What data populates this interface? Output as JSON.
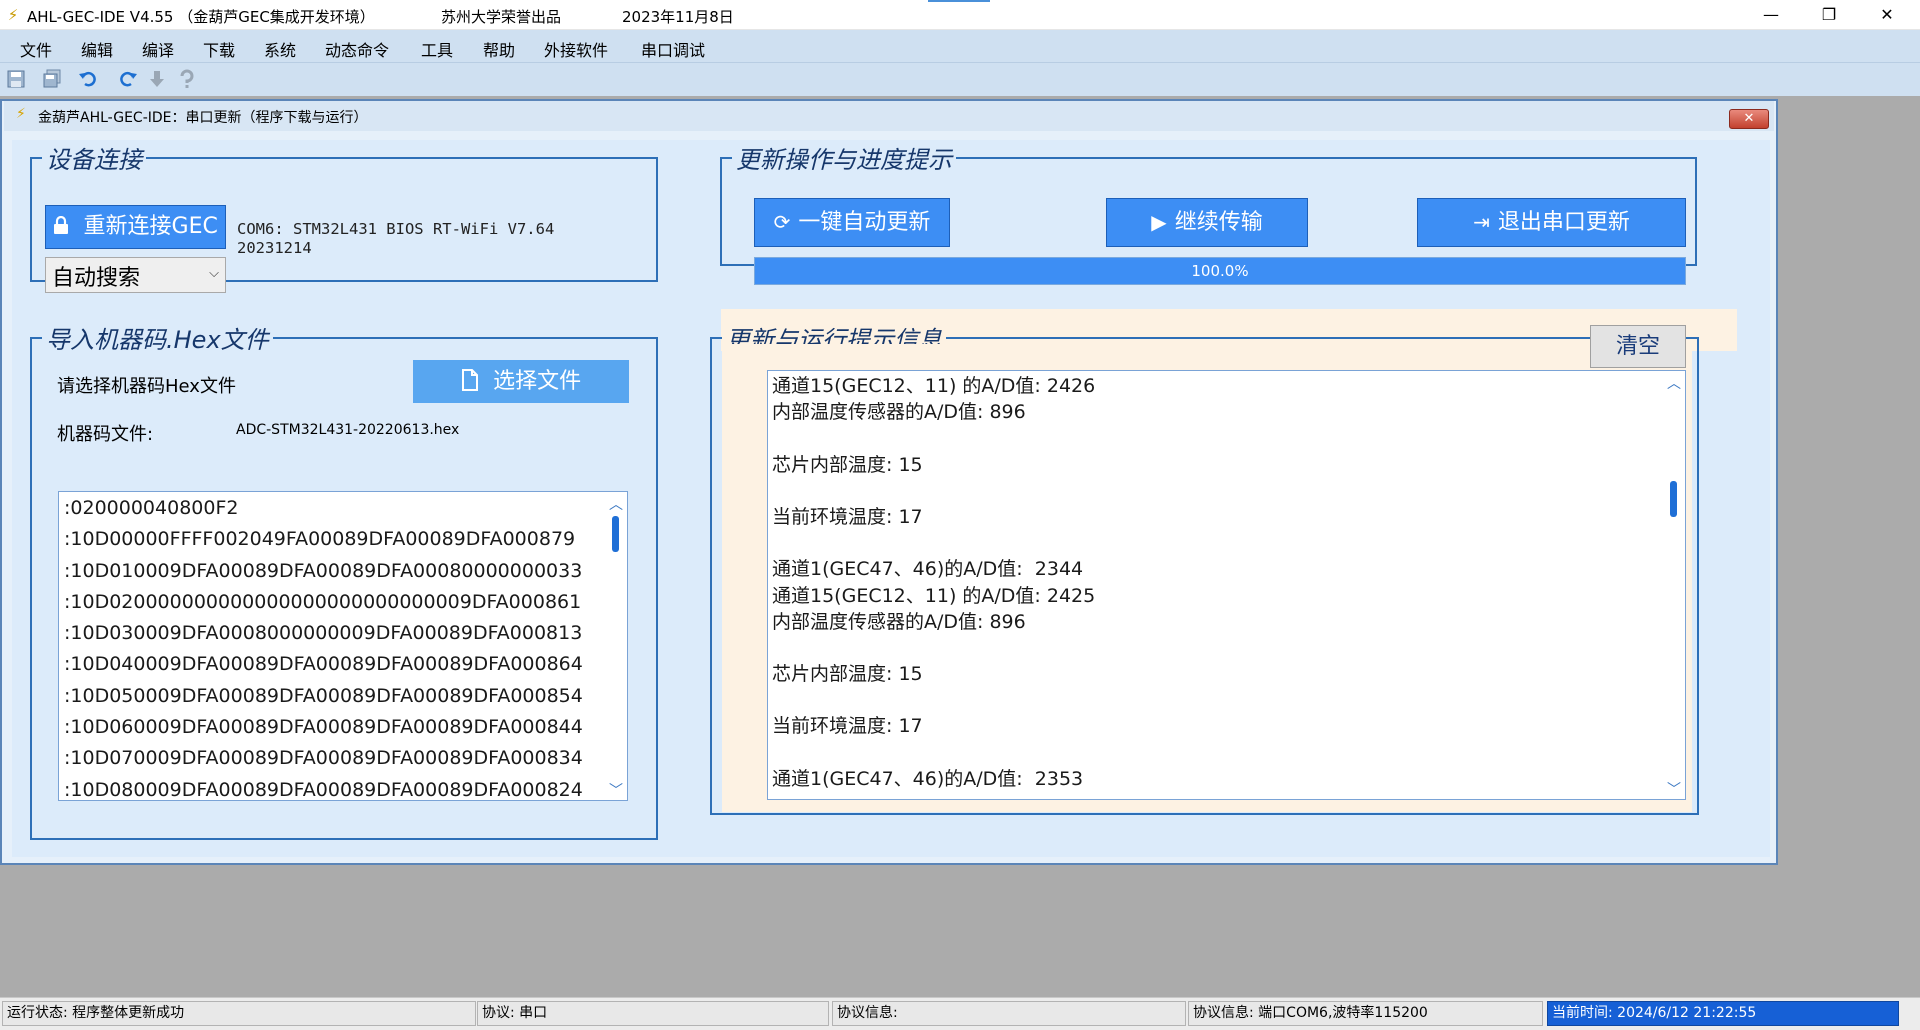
{
  "window": {
    "title": "AHL-GEC-IDE V4.55 （金葫芦GEC集成开发环境）",
    "org": "苏州大学荣誉出品",
    "date": "2023年11月8日",
    "minimize": "—",
    "restore": "❐",
    "close": "✕"
  },
  "menu": [
    "文件",
    "编辑",
    "编译",
    "下载",
    "系统",
    "动态命令",
    "工具",
    "帮助",
    "外接软件",
    "串口调试"
  ],
  "toolbar": [
    "save-icon",
    "save-all-icon",
    "undo-icon",
    "redo-icon",
    "download-icon",
    "help-icon"
  ],
  "dialog": {
    "title": "金葫芦AHL-GEC-IDE：串口更新（程序下载与运行）",
    "close": "✕",
    "device": {
      "legend": "设备连接",
      "reconnect_label": "重新连接GEC",
      "search_mode": "自动搜索",
      "device_info_line1": "COM6:  STM32L431 BIOS RT-WiFi V7.64",
      "device_info_line2": "20231214"
    },
    "import": {
      "legend": "导入机器码.Hex文件",
      "prompt": "请选择机器码Hex文件",
      "choose_label": "选择文件",
      "file_label": "机器码文件:",
      "file_name": "ADC-STM32L431-20220613.hex",
      "hex_lines": [
        ":020000040800F2",
        ":10D00000FFFF002049FA00089DFA00089DFA000879",
        ":10D010009DFA00089DFA00089DFA00080000000033",
        ":10D020000000000000000000000000009DFA000861",
        ":10D030009DFA0008000000009DFA00089DFA000813",
        ":10D040009DFA00089DFA00089DFA00089DFA000864",
        ":10D050009DFA00089DFA00089DFA00089DFA000854",
        ":10D060009DFA00089DFA00089DFA00089DFA000844",
        ":10D070009DFA00089DFA00089DFA00089DFA000834",
        ":10D080009DFA00089DFA00089DFA00089DFA000824"
      ]
    },
    "update": {
      "legend": "更新操作与进度提示",
      "auto_update_label": "一键自动更新",
      "continue_label": "继续传输",
      "exit_label": "退出串口更新",
      "progress_text": "100.0%",
      "progress_value": 1.0
    },
    "log": {
      "legend": "更新与运行提示信息",
      "clear_label": "清空",
      "lines": [
        "通道15(GEC12、11) 的A/D值: 2426",
        "内部温度传感器的A/D值: 896",
        "",
        "芯片内部温度: 15",
        "",
        "当前环境温度: 17",
        "",
        "通道1(GEC47、46)的A/D值:  2344",
        "通道15(GEC12、11) 的A/D值: 2425",
        "内部温度传感器的A/D值: 896",
        "",
        "芯片内部温度: 15",
        "",
        "当前环境温度: 17",
        "",
        "通道1(GEC47、46)的A/D值:  2353"
      ]
    }
  },
  "status": {
    "run_state": "运行状态: 程序整体更新成功",
    "protocol": "协议: 串口",
    "protocol_info": "协议信息:",
    "port_info": "协议信息: 端口COM6,波特率115200",
    "time": "当前时间: 2024/6/12 21:22:55"
  }
}
